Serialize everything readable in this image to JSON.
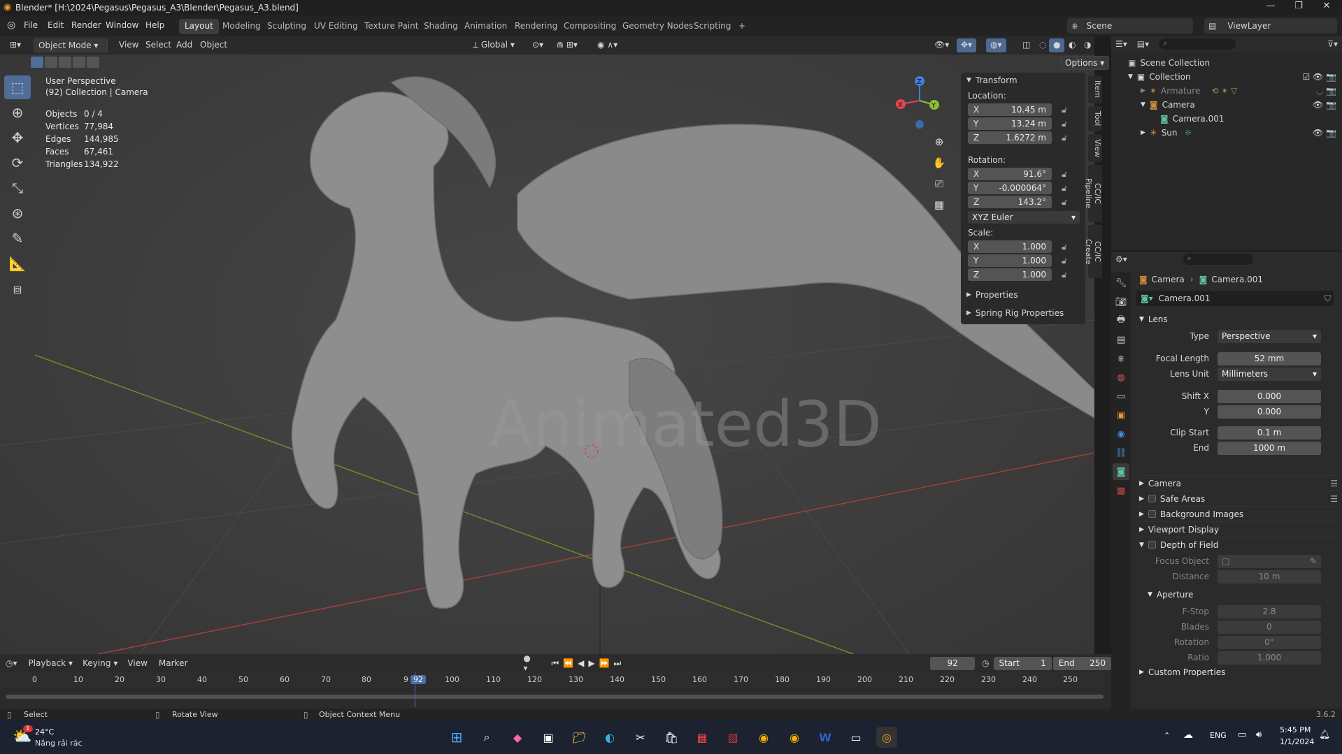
{
  "window": {
    "title": "Blender* [H:\\2024\\Pegasus\\Pegasus_A3\\Blender\\Pegasus_A3.blend]",
    "minimize": "—",
    "maximize": "❐",
    "close": "✕"
  },
  "menubar": {
    "items": [
      "File",
      "Edit",
      "Render",
      "Window",
      "Help"
    ],
    "workspaces": [
      "Layout",
      "Modeling",
      "Sculpting",
      "UV Editing",
      "Texture Paint",
      "Shading",
      "Animation",
      "Rendering",
      "Compositing",
      "Geometry Nodes",
      "Scripting"
    ],
    "active_workspace": "Layout",
    "add_tab": "+",
    "scene_label": "Scene",
    "viewlayer_label": "ViewLayer"
  },
  "viewport_header": {
    "mode": "Object Mode",
    "menus": [
      "View",
      "Select",
      "Add",
      "Object"
    ],
    "orientation": "Global",
    "options": "Options"
  },
  "overlay": {
    "view_name": "User Perspective",
    "collection_line": "(92) Collection | Camera",
    "stats": [
      {
        "label": "Objects",
        "value": "0 / 4"
      },
      {
        "label": "Vertices",
        "value": "77,984"
      },
      {
        "label": "Edges",
        "value": "144,985"
      },
      {
        "label": "Faces",
        "value": "67,461"
      },
      {
        "label": "Triangles",
        "value": "134,922"
      }
    ],
    "watermark": "Animated3D"
  },
  "gizmo": {
    "x": "X",
    "y": "Y",
    "z": "Z"
  },
  "npanel": {
    "transform_title": "Transform",
    "location_label": "Location:",
    "location": [
      {
        "axis": "X",
        "value": "10.45 m"
      },
      {
        "axis": "Y",
        "value": "13.24 m"
      },
      {
        "axis": "Z",
        "value": "1.6272 m"
      }
    ],
    "rotation_label": "Rotation:",
    "rotation": [
      {
        "axis": "X",
        "value": "91.6°"
      },
      {
        "axis": "Y",
        "value": "-0.000064°"
      },
      {
        "axis": "Z",
        "value": "143.2°"
      }
    ],
    "rotation_mode": "XYZ Euler",
    "scale_label": "Scale:",
    "scale": [
      {
        "axis": "X",
        "value": "1.000"
      },
      {
        "axis": "Y",
        "value": "1.000"
      },
      {
        "axis": "Z",
        "value": "1.000"
      }
    ],
    "properties": "Properties",
    "spring": "Spring Rig Properties",
    "tabs": [
      "Item",
      "Tool",
      "View",
      "CC/IC Pipeline",
      "CC/IC Create"
    ]
  },
  "outliner": {
    "scene_collection": "Scene Collection",
    "items": [
      {
        "name": "Collection",
        "depth": 1
      },
      {
        "name": "Armature",
        "depth": 2
      },
      {
        "name": "Camera",
        "depth": 2
      },
      {
        "name": "Camera.001",
        "depth": 3
      },
      {
        "name": "Sun",
        "depth": 2
      }
    ]
  },
  "properties": {
    "breadcrumb_object": "Camera",
    "breadcrumb_data": "Camera.001",
    "datablock": "Camera.001",
    "lens_section": "Lens",
    "type_label": "Type",
    "type_value": "Perspective",
    "focal_label": "Focal Length",
    "focal_value": "52 mm",
    "lens_unit_label": "Lens Unit",
    "lens_unit_value": "Millimeters",
    "shiftx_label": "Shift X",
    "shiftx_value": "0.000",
    "shifty_label": "Y",
    "shifty_value": "0.000",
    "clipstart_label": "Clip Start",
    "clipstart_value": "0.1 m",
    "clipend_label": "End",
    "clipend_value": "1000 m",
    "sections": [
      "Camera",
      "Safe Areas",
      "Background Images",
      "Viewport Display",
      "Depth of Field"
    ],
    "focus_label": "Focus Object",
    "distance_label": "Distance",
    "distance_value": "10 m",
    "aperture": "Aperture",
    "fstop_label": "F-Stop",
    "fstop_value": "2.8",
    "blades_label": "Blades",
    "blades_value": "0",
    "rotation_label": "Rotation",
    "rotation_value": "0°",
    "ratio_label": "Ratio",
    "ratio_value": "1.000",
    "custom": "Custom Properties"
  },
  "timeline": {
    "menus": [
      "Playback",
      "Keying",
      "View",
      "Marker"
    ],
    "current_frame": "92",
    "start_label": "Start",
    "start": "1",
    "end_label": "End",
    "end": "250",
    "ticks": [
      "0",
      "10",
      "20",
      "30",
      "40",
      "50",
      "60",
      "70",
      "80",
      "9",
      "92",
      "100",
      "110",
      "120",
      "130",
      "140",
      "150",
      "160",
      "170",
      "180",
      "190",
      "200",
      "210",
      "220",
      "230",
      "240",
      "250"
    ]
  },
  "statusbar": {
    "select": "Select",
    "rotate": "Rotate View",
    "context": "Object Context Menu",
    "version": "3.6.2"
  },
  "taskbar": {
    "weather_temp": "24°C",
    "weather_desc": "Nắng rải rác",
    "weather_badge": "1",
    "lang": "ENG",
    "time": "5:45 PM",
    "date": "1/1/2024"
  },
  "colors": {
    "accent": "#4f6d96",
    "x_axis": "#e0474e",
    "y_axis": "#8cbf35",
    "z_axis": "#3d82d6",
    "frame": "#4a6fa8"
  }
}
